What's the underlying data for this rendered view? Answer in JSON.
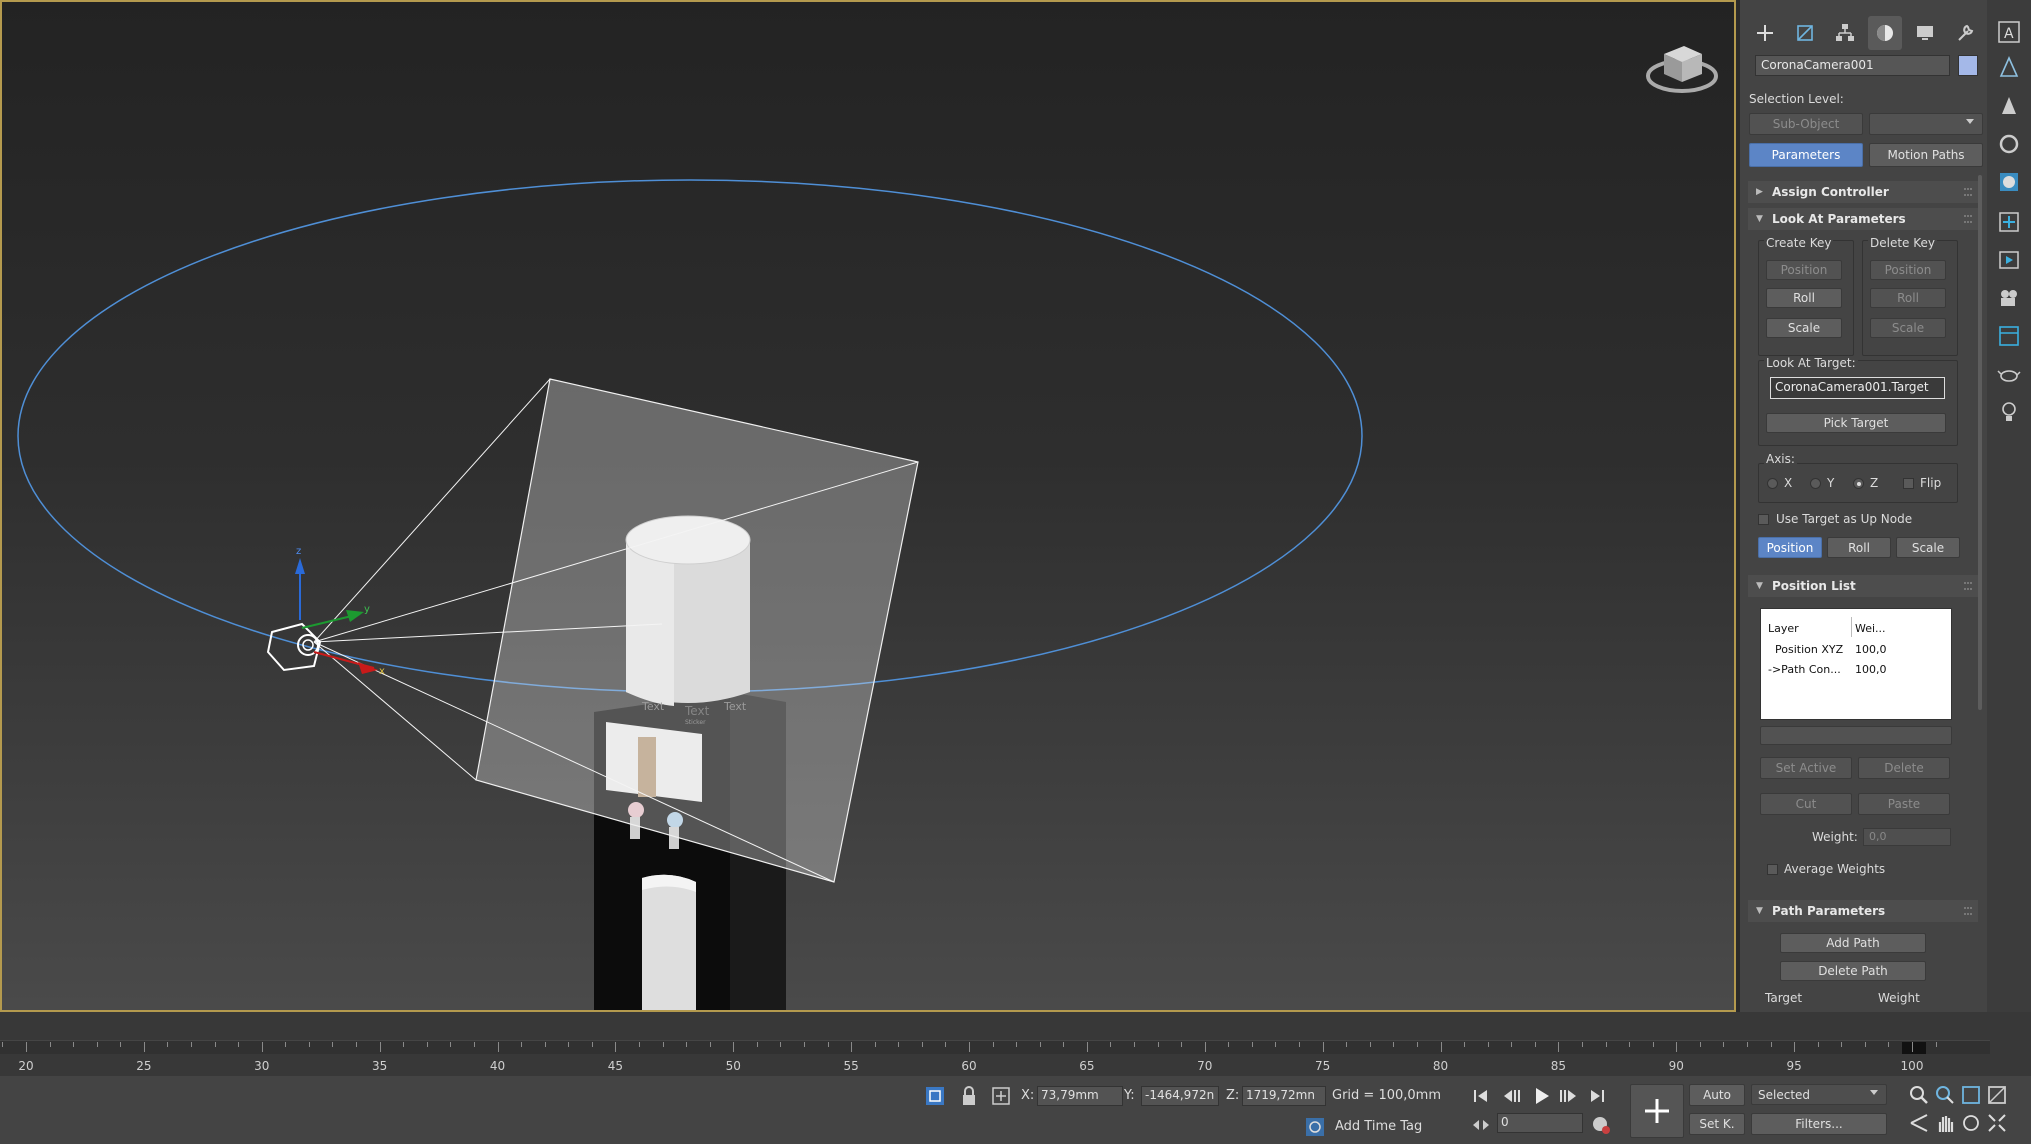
{
  "object": {
    "name": "CoronaCamera001",
    "color": "#a4b8e8"
  },
  "selection_level": {
    "label": "Selection Level:",
    "sub_object": "Sub-Object",
    "parameters": "Parameters",
    "motion_paths": "Motion Paths"
  },
  "rollouts": {
    "assign_controller": "Assign Controller",
    "look_at_parameters": "Look At Parameters",
    "position_list": "Position List",
    "path_parameters": "Path Parameters"
  },
  "look_at": {
    "create_key": "Create Key",
    "delete_key": "Delete Key",
    "create_position": "Position",
    "create_roll": "Roll",
    "create_scale": "Scale",
    "delete_position": "Position",
    "delete_roll": "Roll",
    "delete_scale": "Scale",
    "target_label": "Look At Target:",
    "target_value": "CoronaCamera001.Target",
    "pick_target": "Pick Target",
    "axis_label": "Axis:",
    "axis_x": "X",
    "axis_y": "Y",
    "axis_z": "Z",
    "axis_selected": "Z",
    "flip": "Flip",
    "use_target_up": "Use Target as Up Node",
    "mode_position": "Position",
    "mode_roll": "Roll",
    "mode_scale": "Scale"
  },
  "position_list": {
    "col_layer": "Layer",
    "col_weight": "Wei...",
    "rows": [
      {
        "layer": "Position XYZ",
        "weight": "100,0"
      },
      {
        "layer": "->Path Con...",
        "weight": "100,0"
      }
    ],
    "set_active": "Set Active",
    "delete": "Delete",
    "cut": "Cut",
    "paste": "Paste",
    "weight_label": "Weight:",
    "weight_value": "0,0",
    "average_weights": "Average Weights"
  },
  "path_parameters": {
    "add_path": "Add Path",
    "delete_path": "Delete Path",
    "col_target": "Target",
    "col_weight": "Weight"
  },
  "scene": {
    "axis_x": "x",
    "axis_y": "y",
    "axis_z": "z",
    "bottle_text": "Text",
    "bottle_sub": "Sticker"
  },
  "timeline": {
    "ticks": [
      "20",
      "25",
      "30",
      "35",
      "40",
      "45",
      "50",
      "55",
      "60",
      "65",
      "70",
      "75",
      "80",
      "85",
      "90",
      "95",
      "100"
    ]
  },
  "status": {
    "x_label": "X:",
    "x_value": "73,79mm",
    "y_label": "Y:",
    "y_value": "-1464,972n",
    "z_label": "Z:",
    "z_value": "1719,72mn",
    "grid": "Grid = 100,0mm",
    "add_time_tag": "Add Time Tag",
    "frame_value": "0",
    "auto": "Auto",
    "set_key": "Set K.",
    "selected": "Selected",
    "filters": "Filters..."
  }
}
